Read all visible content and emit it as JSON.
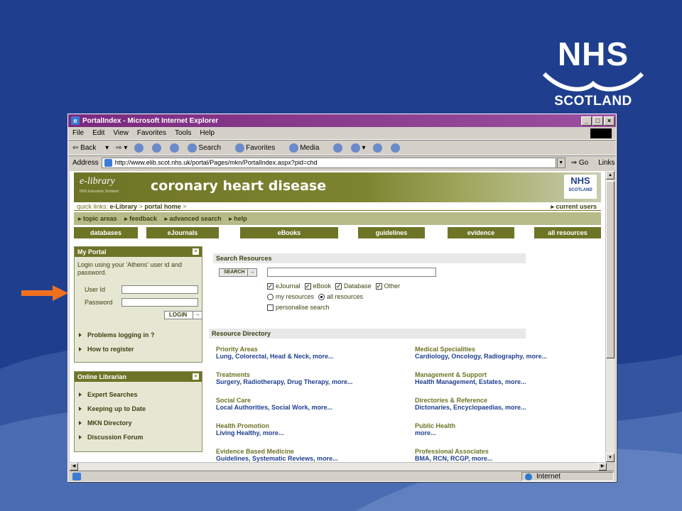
{
  "slide": {
    "logo_nhs": "NHS",
    "logo_scotland": "SCOTLAND",
    "background_color": "#1f3f8e",
    "arrow_color": "#f07020"
  },
  "browser": {
    "title": "PortalIndex - Microsoft Internet Explorer",
    "menu": [
      "File",
      "Edit",
      "View",
      "Favorites",
      "Tools",
      "Help"
    ],
    "toolbar": [
      "Back",
      "Search",
      "Favorites",
      "Media"
    ],
    "address_label": "Address",
    "url": "http://www.elib.scot.nhs.uk/portal/Pages/mkn/PortalIndex.aspx?pid=chd",
    "go_label": "Go",
    "links_label": "Links",
    "status_zone": "Internet"
  },
  "site": {
    "elib_logo": "e-library",
    "elib_sub": "NHS Education Scotland",
    "title": "coronary heart disease",
    "logo_nhs": "NHS",
    "logo_scotland": "SCOTLAND",
    "quick_label": "quick links: ",
    "quick_elib": "e-Library",
    "quick_sep": " > ",
    "quick_portal": "portal home",
    "quick_end": " >",
    "current_users": "▸ current users",
    "nav": [
      "▸ topic areas",
      "▸ feedback",
      "▸ advanced search",
      "▸ help"
    ],
    "tabs": [
      "databases",
      "eJournals",
      "eBooks",
      "guidelines",
      "evidence",
      "all resources"
    ],
    "accent_color": "#6e7426"
  },
  "my_portal": {
    "title": "My Portal",
    "intro": "Login using your 'Athens' user id and password.",
    "user_label": "User Id",
    "password_label": "Password",
    "login_label": "LOGIN",
    "links": [
      "Problems logging in ?",
      "How to register"
    ]
  },
  "online_librarian": {
    "title": "Online Librarian",
    "links": [
      "Expert Searches",
      "Keeping up to Date",
      "MKN Directory",
      "Discussion Forum"
    ]
  },
  "search": {
    "title": "Search Resources",
    "button": "SEARCH",
    "types": [
      "eJournal",
      "eBook",
      "Database",
      "Other"
    ],
    "scope": [
      "my resources",
      "all resources"
    ],
    "personalise": "personalise search"
  },
  "directory": {
    "title": "Resource Directory",
    "items": [
      {
        "h": "Priority Areas",
        "d": "Lung, Colorectal, Head & Neck, more..."
      },
      {
        "h": "Medical Specialities",
        "d": "Cardiology, Oncology, Radiography, more..."
      },
      {
        "h": "Treatments",
        "d": "Surgery, Radiotherapy, Drug Therapy, more..."
      },
      {
        "h": "Management & Support",
        "d": "Health Management, Estates, more..."
      },
      {
        "h": "Social Care",
        "d": "Local Authorities, Social Work, more..."
      },
      {
        "h": "Directories & Reference",
        "d": "Dictonaries, Encyclopaedias, more..."
      },
      {
        "h": "Health Promotion",
        "d": "Living Healthy, more..."
      },
      {
        "h": "Public Health",
        "d": "more..."
      },
      {
        "h": "Evidence Based Medicine",
        "d": "Guidelines, Systematic Reviews, more..."
      },
      {
        "h": "Professional Associates",
        "d": "BMA, RCN, RCGP, more..."
      }
    ]
  }
}
